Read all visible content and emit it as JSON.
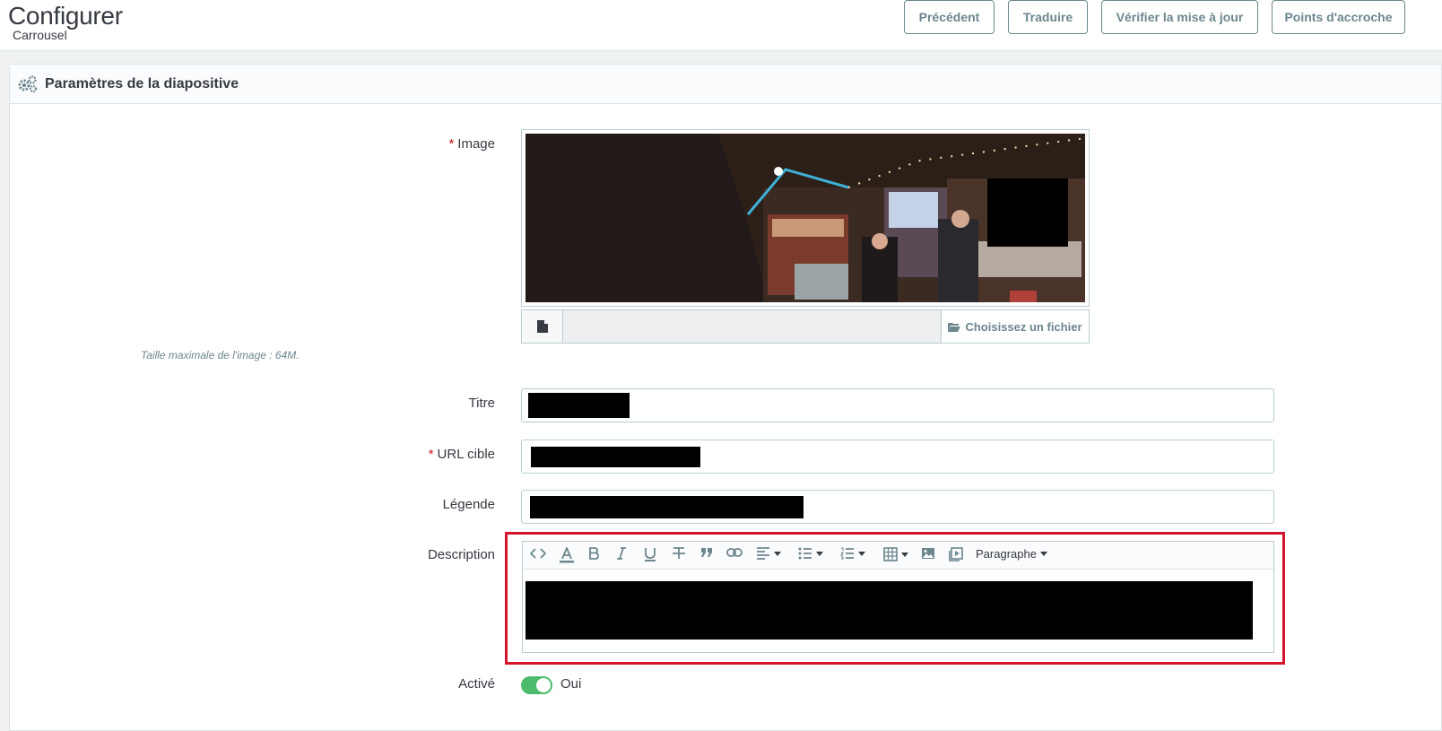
{
  "header": {
    "title": "Configurer",
    "breadcrumb": "Carrousel",
    "buttons": {
      "previous": "Précédent",
      "translate": "Traduire",
      "check_update": "Vérifier la mise à jour",
      "hooks": "Points d'accroche"
    }
  },
  "panel": {
    "title": "Paramètres de la diapositive",
    "icon": "gears-icon"
  },
  "form": {
    "image": {
      "label": "Image",
      "required_mark": "*",
      "choose_file_label": "Choisissez un fichier",
      "help": "Taille maximale de l'image : 64M."
    },
    "title_field": {
      "label": "Titre"
    },
    "url_field": {
      "label": "URL cible",
      "required_mark": "*"
    },
    "legend_field": {
      "label": "Légende"
    },
    "description": {
      "label": "Description",
      "toolbar": {
        "format_label": "Paragraphe"
      }
    },
    "active": {
      "label": "Activé",
      "value_label": "Oui",
      "enabled": true
    }
  },
  "colors": {
    "accent": "#25b9d7",
    "switch_on": "#4cbb6c",
    "highlight_outline": "#d4142b",
    "required": "#c0141b"
  }
}
